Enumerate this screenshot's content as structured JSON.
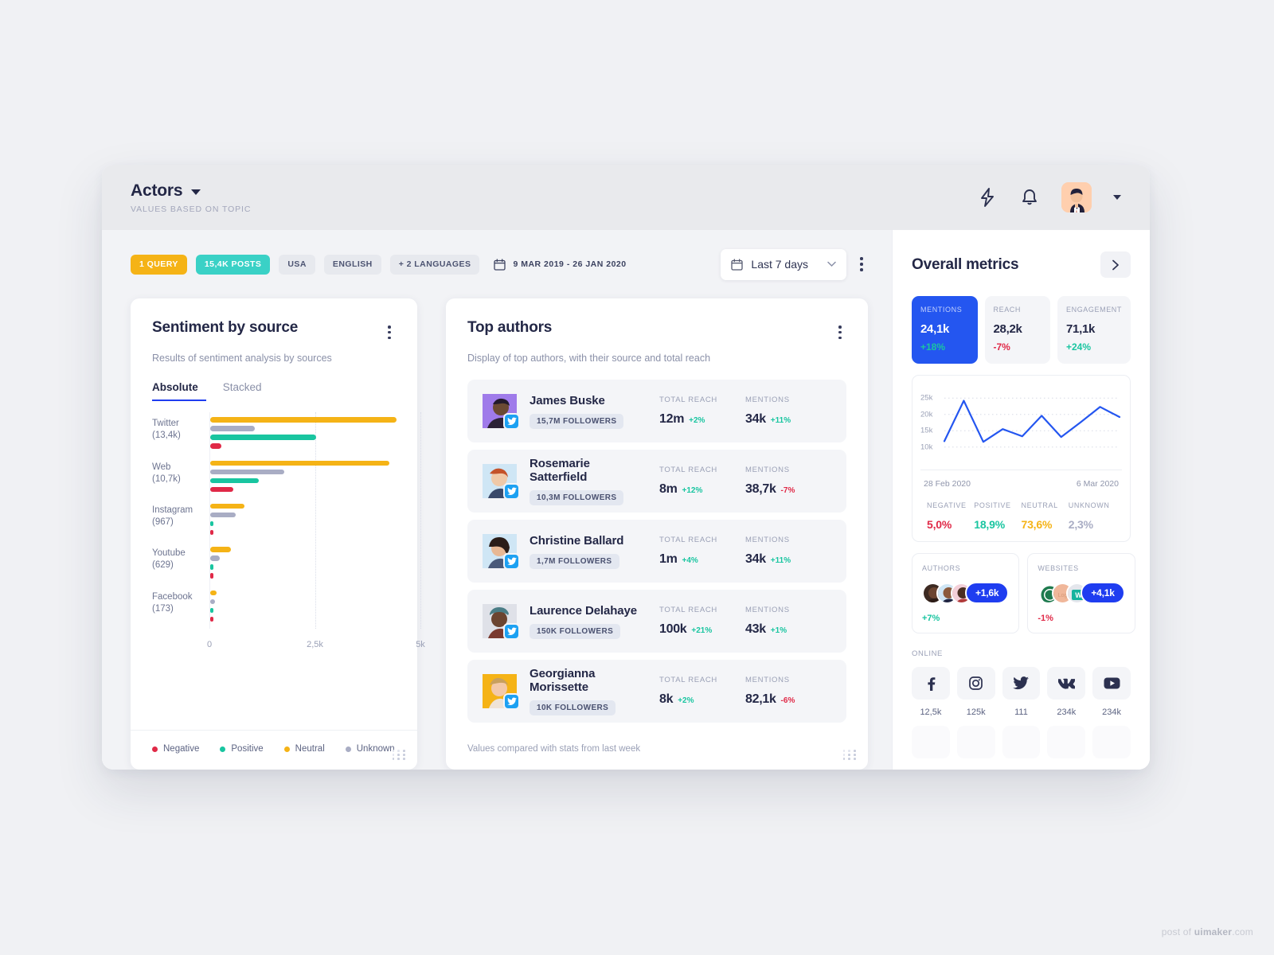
{
  "header": {
    "title": "Actors",
    "subtitle": "VALUES BASED ON TOPIC",
    "caret_icon": "chevron-down-icon",
    "bolt_icon": "lightning-bolt-icon",
    "bell_icon": "bell-icon",
    "avatar_icon": "user-avatar"
  },
  "filters": {
    "chips": [
      {
        "label": "1 QUERY",
        "style": "query"
      },
      {
        "label": "15,4K POSTS",
        "style": "posts"
      },
      {
        "label": "USA",
        "style": "plain"
      },
      {
        "label": "ENGLISH",
        "style": "plain"
      },
      {
        "label": "+ 2 LANGUAGES",
        "style": "plain"
      }
    ],
    "calendar_icon": "calendar-icon",
    "date_range": "9 MAR 2019 - 26 JAN 2020",
    "range_select": "Last 7 days",
    "more_icon": "kebab-menu-icon"
  },
  "sentiment_card": {
    "title": "Sentiment by source",
    "subtitle": "Results of sentiment analysis by sources",
    "menu_icon": "kebab-menu-icon",
    "tabs": [
      {
        "label": "Absolute",
        "active": true
      },
      {
        "label": "Stacked",
        "active": false
      }
    ],
    "legend": [
      {
        "label": "Negative",
        "color": "#e02947"
      },
      {
        "label": "Positive",
        "color": "#19c5a0"
      },
      {
        "label": "Neutral",
        "color": "#f5b316"
      },
      {
        "label": "Unknown",
        "color": "#a9adc4"
      }
    ]
  },
  "chart_data": [
    {
      "type": "bar",
      "title": "Sentiment by source",
      "orientation": "horizontal",
      "xlabel": "",
      "ylabel": "",
      "xlim": [
        0,
        5000
      ],
      "ticks": [
        "0",
        "2,5k",
        "5k"
      ],
      "tick_values": [
        0,
        2500,
        5000
      ],
      "grid": true,
      "categories": [
        "Twitter",
        "Web",
        "Instagram",
        "Youtube",
        "Facebook"
      ],
      "category_totals": [
        "(13,4k)",
        "(10,7k)",
        "(967)",
        "(629)",
        "(173)"
      ],
      "series": [
        {
          "name": "Neutral",
          "color": "#f5b316",
          "values": [
            4420,
            4240,
            820,
            490,
            160
          ]
        },
        {
          "name": "Unknown",
          "color": "#a9adc4",
          "values": [
            1060,
            1760,
            600,
            230,
            110
          ]
        },
        {
          "name": "Positive",
          "color": "#19c5a0",
          "values": [
            2500,
            1160,
            40,
            40,
            30
          ]
        },
        {
          "name": "Negative",
          "color": "#e02947",
          "values": [
            260,
            540,
            40,
            40,
            30
          ]
        }
      ]
    },
    {
      "type": "line",
      "title": "Mentions over time",
      "ylim": [
        8000,
        27000
      ],
      "yticks": [
        "10k",
        "15k",
        "20k",
        "25k"
      ],
      "ytick_values": [
        10000,
        15000,
        20000,
        25000
      ],
      "grid": true,
      "x_start": "28 Feb 2020",
      "x_end": "6 Mar 2020",
      "color": "#2456f0",
      "values": [
        11800,
        24200,
        11600,
        15500,
        13300,
        19600,
        13100,
        17600,
        22300,
        19200
      ]
    }
  ],
  "authors_card": {
    "title": "Top authors",
    "subtitle": "Display of top authors, with their source and total reach",
    "menu_icon": "kebab-menu-icon",
    "col_reach": "TOTAL REACH",
    "col_mentions": "MENTIONS",
    "footnote": "Values compared with stats from last week",
    "rows": [
      {
        "name": "James Buske",
        "followers": "15,7M FOLLOWERS",
        "source_icon": "twitter-icon",
        "reach": "12m",
        "reach_delta": "+2%",
        "reach_dir": "up",
        "mentions": "34k",
        "mentions_delta": "+11%",
        "mentions_dir": "up",
        "avatar_bg": "#9f7bea"
      },
      {
        "name": "Rosemarie Satterfield",
        "followers": "10,3M FOLLOWERS",
        "source_icon": "twitter-icon",
        "reach": "8m",
        "reach_delta": "+12%",
        "reach_dir": "up",
        "mentions": "38,7k",
        "mentions_delta": "-7%",
        "mentions_dir": "down",
        "avatar_bg": "#cfe6f5"
      },
      {
        "name": "Christine Ballard",
        "followers": "1,7M FOLLOWERS",
        "source_icon": "twitter-icon",
        "reach": "1m",
        "reach_delta": "+4%",
        "reach_dir": "up",
        "mentions": "34k",
        "mentions_delta": "+11%",
        "mentions_dir": "up",
        "avatar_bg": "#cfe6f5"
      },
      {
        "name": "Laurence Delahaye",
        "followers": "150K FOLLOWERS",
        "source_icon": "twitter-icon",
        "reach": "100k",
        "reach_delta": "+21%",
        "reach_dir": "up",
        "mentions": "43k",
        "mentions_delta": "+1%",
        "mentions_dir": "up",
        "avatar_bg": "#dfe1e8"
      },
      {
        "name": "Georgianna Morissette",
        "followers": "10K FOLLOWERS",
        "source_icon": "twitter-icon",
        "reach": "8k",
        "reach_delta": "+2%",
        "reach_dir": "up",
        "mentions": "82,1k",
        "mentions_delta": "-6%",
        "mentions_dir": "down",
        "avatar_bg": "#f5b316"
      }
    ]
  },
  "sidebar": {
    "title": "Overall metrics",
    "expand_icon": "chevron-right-icon",
    "kpis": [
      {
        "label": "MENTIONS",
        "value": "24,1k",
        "delta": "+18%",
        "dir": "up",
        "active": true
      },
      {
        "label": "REACH",
        "value": "28,2k",
        "delta": "-7%",
        "dir": "down",
        "active": false
      },
      {
        "label": "ENGAGEMENT",
        "value": "71,1k",
        "delta": "+24%",
        "dir": "up",
        "active": false
      }
    ],
    "sentiments": [
      {
        "label": "NEGATIVE",
        "value": "5,0%",
        "color": "#e02947"
      },
      {
        "label": "POSITIVE",
        "value": "18,9%",
        "color": "#19c5a0"
      },
      {
        "label": "NEUTRAL",
        "value": "73,6%",
        "color": "#f5b316"
      },
      {
        "label": "UNKNOWN",
        "value": "2,3%",
        "color": "#a9adc4"
      }
    ],
    "group_cards": [
      {
        "label": "AUTHORS",
        "pill": "+1,6k",
        "delta": "+7%",
        "dir": "up"
      },
      {
        "label": "WEBSITES",
        "pill": "+4,1k",
        "delta": "-1%",
        "dir": "down"
      }
    ],
    "online_label": "ONLINE",
    "socials": [
      {
        "icon": "facebook-icon",
        "count": "12,5k"
      },
      {
        "icon": "instagram-icon",
        "count": "125k"
      },
      {
        "icon": "twitter-icon",
        "count": "111"
      },
      {
        "icon": "vk-icon",
        "count": "234k"
      },
      {
        "icon": "youtube-icon",
        "count": "234k"
      }
    ]
  },
  "watermark": {
    "prefix": "post of ",
    "brand": "uimaker",
    "suffix": ".com"
  }
}
